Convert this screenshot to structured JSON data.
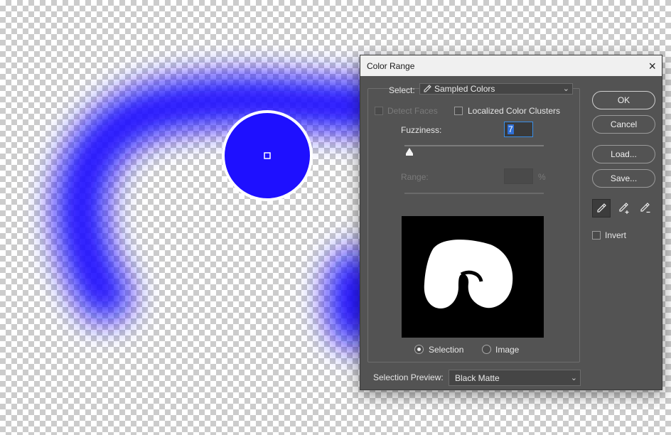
{
  "dialog": {
    "title": "Color Range",
    "close_glyph": "×",
    "select_label": "Select:",
    "select_value": "Sampled Colors",
    "detect_faces_label": "Detect Faces",
    "detect_faces_checked": false,
    "localized_label": "Localized Color Clusters",
    "localized_checked": false,
    "fuzziness_label": "Fuzziness:",
    "fuzziness_value": "7",
    "fuzziness_fraction": 0.035,
    "range_label": "Range:",
    "range_value": "",
    "range_unit": "%",
    "radio_selection_label": "Selection",
    "radio_image_label": "Image",
    "radio_selected": "Selection",
    "invert_label": "Invert",
    "invert_checked": false,
    "preview_label": "Selection Preview:",
    "preview_value": "Black Matte",
    "buttons": {
      "ok": "OK",
      "cancel": "Cancel",
      "load": "Load...",
      "save": "Save..."
    },
    "eyedroppers": [
      "eyedropper-icon",
      "eyedropper-plus-icon",
      "eyedropper-minus-icon"
    ]
  },
  "canvas": {
    "stroke_color": "#1e10ff",
    "sampler_color": "#1e10ff"
  },
  "colors": {
    "dialog_bg": "#535353",
    "titlebar_bg": "#f0f0f0",
    "focus_accent": "#3a8ee6"
  }
}
